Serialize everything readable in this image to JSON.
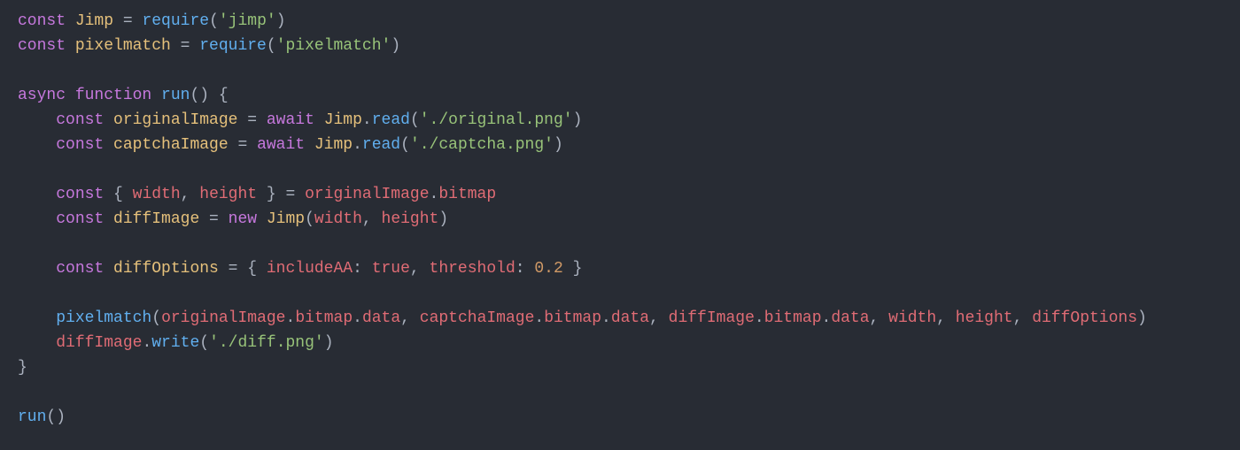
{
  "code": {
    "tokens": [
      [
        {
          "t": "const ",
          "c": "kw"
        },
        {
          "t": "Jimp",
          "c": "decl"
        },
        {
          "t": " = ",
          "c": "punct"
        },
        {
          "t": "require",
          "c": "fn"
        },
        {
          "t": "(",
          "c": "punct"
        },
        {
          "t": "'jimp'",
          "c": "str"
        },
        {
          "t": ")",
          "c": "punct"
        }
      ],
      [
        {
          "t": "const ",
          "c": "kw"
        },
        {
          "t": "pixelmatch",
          "c": "decl"
        },
        {
          "t": " = ",
          "c": "punct"
        },
        {
          "t": "require",
          "c": "fn"
        },
        {
          "t": "(",
          "c": "punct"
        },
        {
          "t": "'pixelmatch'",
          "c": "str"
        },
        {
          "t": ")",
          "c": "punct"
        }
      ],
      [],
      [
        {
          "t": "async ",
          "c": "kw"
        },
        {
          "t": "function ",
          "c": "kw"
        },
        {
          "t": "run",
          "c": "fn"
        },
        {
          "t": "() {",
          "c": "punct"
        }
      ],
      [
        {
          "t": "    ",
          "c": "punct"
        },
        {
          "t": "const ",
          "c": "kw"
        },
        {
          "t": "originalImage",
          "c": "decl"
        },
        {
          "t": " = ",
          "c": "punct"
        },
        {
          "t": "await ",
          "c": "kw"
        },
        {
          "t": "Jimp",
          "c": "class"
        },
        {
          "t": ".",
          "c": "punct"
        },
        {
          "t": "read",
          "c": "fn"
        },
        {
          "t": "(",
          "c": "punct"
        },
        {
          "t": "'./original.png'",
          "c": "str"
        },
        {
          "t": ")",
          "c": "punct"
        }
      ],
      [
        {
          "t": "    ",
          "c": "punct"
        },
        {
          "t": "const ",
          "c": "kw"
        },
        {
          "t": "captchaImage",
          "c": "decl"
        },
        {
          "t": " = ",
          "c": "punct"
        },
        {
          "t": "await ",
          "c": "kw"
        },
        {
          "t": "Jimp",
          "c": "class"
        },
        {
          "t": ".",
          "c": "punct"
        },
        {
          "t": "read",
          "c": "fn"
        },
        {
          "t": "(",
          "c": "punct"
        },
        {
          "t": "'./captcha.png'",
          "c": "str"
        },
        {
          "t": ")",
          "c": "punct"
        }
      ],
      [],
      [
        {
          "t": "    ",
          "c": "punct"
        },
        {
          "t": "const ",
          "c": "kw"
        },
        {
          "t": "{ ",
          "c": "punct"
        },
        {
          "t": "width",
          "c": "destr"
        },
        {
          "t": ", ",
          "c": "punct"
        },
        {
          "t": "height",
          "c": "destr"
        },
        {
          "t": " } = ",
          "c": "punct"
        },
        {
          "t": "originalImage",
          "c": "var"
        },
        {
          "t": ".",
          "c": "punct"
        },
        {
          "t": "bitmap",
          "c": "prop"
        }
      ],
      [
        {
          "t": "    ",
          "c": "punct"
        },
        {
          "t": "const ",
          "c": "kw"
        },
        {
          "t": "diffImage",
          "c": "decl"
        },
        {
          "t": " = ",
          "c": "punct"
        },
        {
          "t": "new ",
          "c": "kw"
        },
        {
          "t": "Jimp",
          "c": "class"
        },
        {
          "t": "(",
          "c": "punct"
        },
        {
          "t": "width",
          "c": "var"
        },
        {
          "t": ", ",
          "c": "punct"
        },
        {
          "t": "height",
          "c": "var"
        },
        {
          "t": ")",
          "c": "punct"
        }
      ],
      [],
      [
        {
          "t": "    ",
          "c": "punct"
        },
        {
          "t": "const ",
          "c": "kw"
        },
        {
          "t": "diffOptions",
          "c": "decl"
        },
        {
          "t": " = { ",
          "c": "punct"
        },
        {
          "t": "includeAA",
          "c": "prop"
        },
        {
          "t": ": ",
          "c": "punct"
        },
        {
          "t": "true",
          "c": "true"
        },
        {
          "t": ", ",
          "c": "punct"
        },
        {
          "t": "threshold",
          "c": "prop"
        },
        {
          "t": ": ",
          "c": "punct"
        },
        {
          "t": "0.2",
          "c": "num"
        },
        {
          "t": " }",
          "c": "punct"
        }
      ],
      [],
      [
        {
          "t": "    ",
          "c": "punct"
        },
        {
          "t": "pixelmatch",
          "c": "fn"
        },
        {
          "t": "(",
          "c": "punct"
        },
        {
          "t": "originalImage",
          "c": "var"
        },
        {
          "t": ".",
          "c": "punct"
        },
        {
          "t": "bitmap",
          "c": "prop"
        },
        {
          "t": ".",
          "c": "punct"
        },
        {
          "t": "data",
          "c": "prop"
        },
        {
          "t": ", ",
          "c": "punct"
        },
        {
          "t": "captchaImage",
          "c": "var"
        },
        {
          "t": ".",
          "c": "punct"
        },
        {
          "t": "bitmap",
          "c": "prop"
        },
        {
          "t": ".",
          "c": "punct"
        },
        {
          "t": "data",
          "c": "prop"
        },
        {
          "t": ", ",
          "c": "punct"
        },
        {
          "t": "diffImage",
          "c": "var"
        },
        {
          "t": ".",
          "c": "punct"
        },
        {
          "t": "bitmap",
          "c": "prop"
        },
        {
          "t": ".",
          "c": "punct"
        },
        {
          "t": "data",
          "c": "prop"
        },
        {
          "t": ", ",
          "c": "punct"
        },
        {
          "t": "width",
          "c": "var"
        },
        {
          "t": ", ",
          "c": "punct"
        },
        {
          "t": "height",
          "c": "var"
        },
        {
          "t": ", ",
          "c": "punct"
        },
        {
          "t": "diffOptions",
          "c": "var"
        },
        {
          "t": ")",
          "c": "punct"
        }
      ],
      [
        {
          "t": "    ",
          "c": "punct"
        },
        {
          "t": "diffImage",
          "c": "var"
        },
        {
          "t": ".",
          "c": "punct"
        },
        {
          "t": "write",
          "c": "fn"
        },
        {
          "t": "(",
          "c": "punct"
        },
        {
          "t": "'./diff.png'",
          "c": "str"
        },
        {
          "t": ")",
          "c": "punct"
        }
      ],
      [
        {
          "t": "}",
          "c": "punct"
        }
      ],
      [],
      [
        {
          "t": "run",
          "c": "fn"
        },
        {
          "t": "()",
          "c": "punct"
        }
      ]
    ]
  }
}
